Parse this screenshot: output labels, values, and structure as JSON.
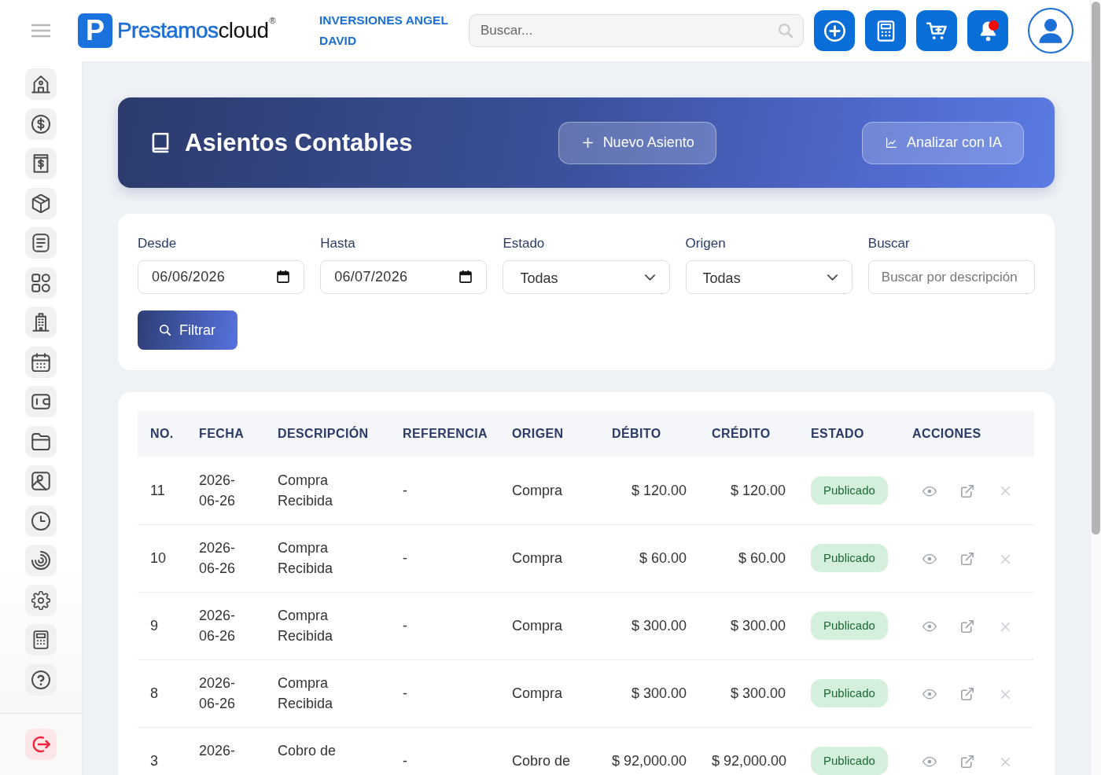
{
  "topbar": {
    "brand": {
      "mark": "P",
      "name_primary": "Prestamos",
      "name_secondary": "cloud",
      "registered": "®"
    },
    "company": "INVERSIONES ANGEL DAVID",
    "search": {
      "placeholder": "Buscar..."
    },
    "actions": [
      {
        "kind": "add",
        "dot": false
      },
      {
        "kind": "calculator",
        "dot": false
      },
      {
        "kind": "cart",
        "dot": false
      },
      {
        "kind": "notifications",
        "dot": true
      }
    ]
  },
  "sidebar": {
    "items": [
      {
        "kind": "house"
      },
      {
        "kind": "dollar-coin"
      },
      {
        "kind": "bill"
      },
      {
        "kind": "box"
      },
      {
        "kind": "document"
      },
      {
        "kind": "apps"
      },
      {
        "kind": "building"
      },
      {
        "kind": "calendar"
      },
      {
        "kind": "wallet"
      },
      {
        "kind": "folder"
      },
      {
        "kind": "image"
      },
      {
        "kind": "clock"
      },
      {
        "kind": "spinner"
      },
      {
        "kind": "gear"
      },
      {
        "kind": "calculator"
      },
      {
        "kind": "help"
      }
    ]
  },
  "page_header": {
    "title": "Asientos Contables",
    "buttons": [
      {
        "kind": "new",
        "label": "Nuevo Asiento"
      },
      {
        "kind": "analyze",
        "label": "Analizar con IA"
      }
    ]
  },
  "filters": {
    "fields": [
      {
        "kind": "date",
        "label": "Desde",
        "value": "06/06/2026"
      },
      {
        "kind": "date",
        "label": "Hasta",
        "value": "06/07/2026"
      },
      {
        "kind": "select",
        "label": "Estado",
        "value": "Todas"
      },
      {
        "kind": "select",
        "label": "Origen",
        "value": "Todas"
      },
      {
        "kind": "text",
        "label": "Buscar",
        "placeholder": "Buscar por descripción"
      }
    ],
    "button": "Filtrar"
  },
  "table": {
    "columns": [
      "NO.",
      "FECHA",
      "DESCRIPCIÓN",
      "REFERENCIA",
      "ORIGEN",
      "DÉBITO",
      "CRÉDITO",
      "ESTADO",
      "ACCIONES"
    ],
    "rows": [
      {
        "no": "11",
        "fecha": "2026-06-26",
        "descripcion": "Compra Recibida",
        "referencia": "-",
        "origen": "Compra",
        "debito": "$ 120.00",
        "credito": "$ 120.00",
        "estado": "Publicado"
      },
      {
        "no": "10",
        "fecha": "2026-06-26",
        "descripcion": "Compra Recibida",
        "referencia": "-",
        "origen": "Compra",
        "debito": "$ 60.00",
        "credito": "$ 60.00",
        "estado": "Publicado"
      },
      {
        "no": "9",
        "fecha": "2026-06-26",
        "descripcion": "Compra Recibida",
        "referencia": "-",
        "origen": "Compra",
        "debito": "$ 300.00",
        "credito": "$ 300.00",
        "estado": "Publicado"
      },
      {
        "no": "8",
        "fecha": "2026-06-26",
        "descripcion": "Compra Recibida",
        "referencia": "-",
        "origen": "Compra",
        "debito": "$ 300.00",
        "credito": "$ 300.00",
        "estado": "Publicado"
      },
      {
        "no": "3",
        "fecha": "2026-",
        "descripcion": "Cobro de",
        "referencia": "-",
        "origen": "Cobro de",
        "debito": "$ 92,000.00",
        "credito": "$ 92,000.00",
        "estado": "Publicado"
      }
    ]
  }
}
